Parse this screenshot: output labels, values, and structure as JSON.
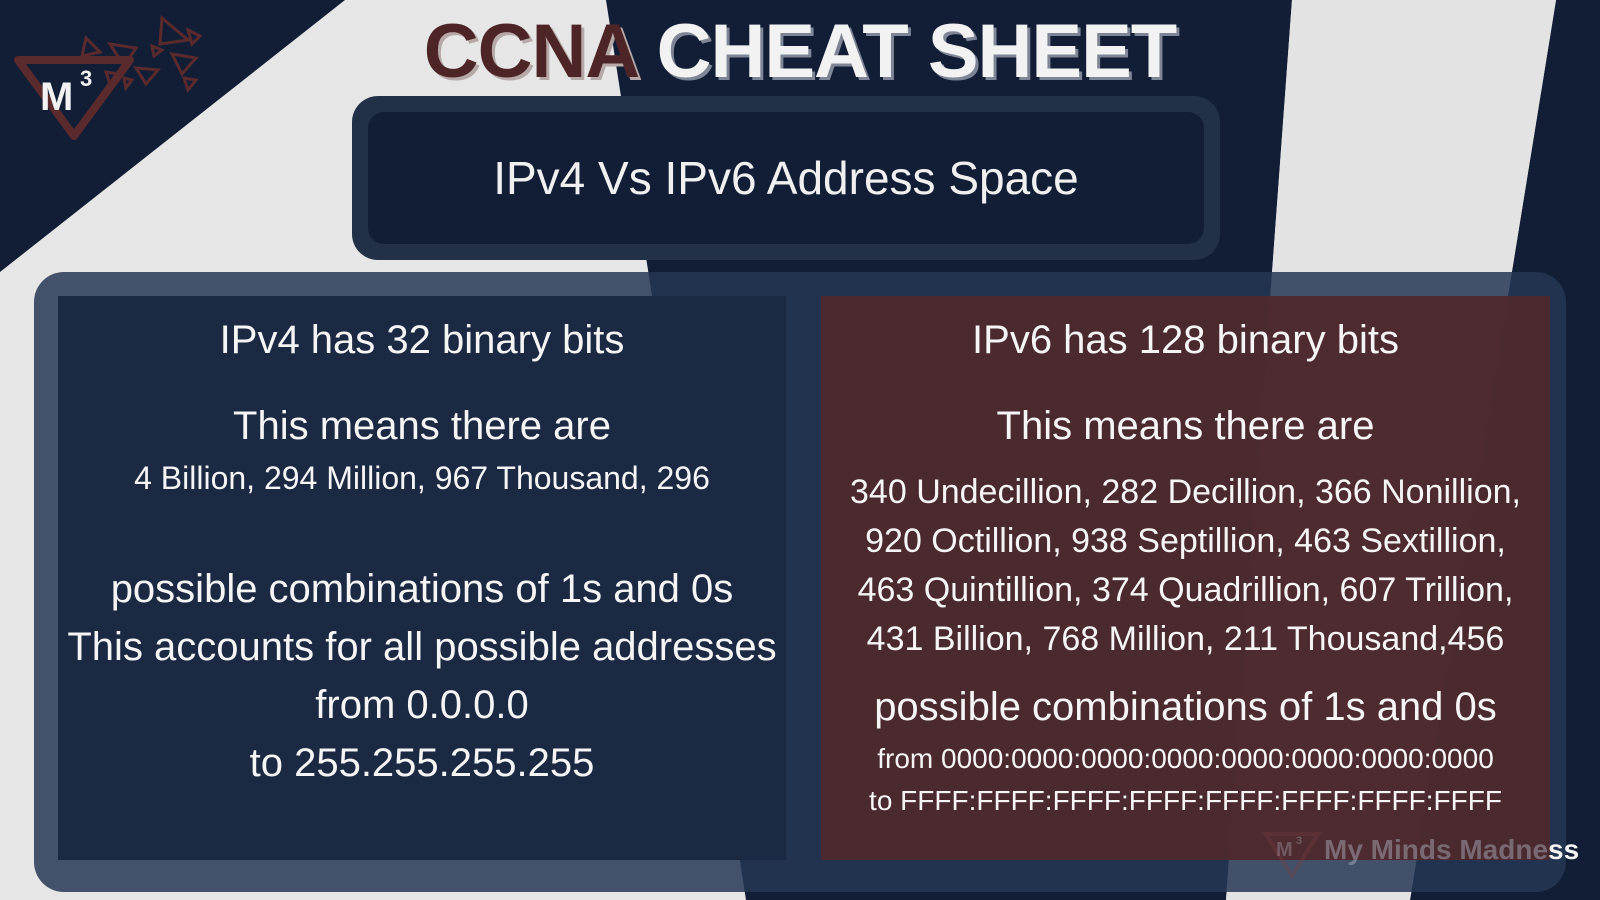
{
  "title": {
    "word1": "CCNA",
    "word2": "CHEAT SHEET"
  },
  "logo": {
    "mark": "M",
    "superscript": "3"
  },
  "subtitle": "IPv4 Vs IPv6 Address Space",
  "ipv4": {
    "heading": "IPv4 has 32 binary bits",
    "means": "This means there are",
    "count": "4 Billion, 294 Million, 967 Thousand, 296",
    "lines": [
      "possible combinations of 1s and 0s",
      "This accounts for all possible addresses",
      "from 0.0.0.0",
      "to 255.255.255.255"
    ]
  },
  "ipv6": {
    "heading": "IPv6 has 128 binary bits",
    "means": "This means there are",
    "count_lines": [
      "340 Undecillion, 282 Decillion, 366 Nonillion,",
      "920 Octillion, 938 Septillion, 463 Sextillion,",
      "463 Quintillion, 374 Quadrillion, 607 Trillion,",
      "431 Billion, 768 Million, 211 Thousand,456"
    ],
    "combinations": "possible combinations of 1s and 0s",
    "from": "from 0000:0000:0000:0000:0000:0000:0000:0000",
    "to": "to FFFF:FFFF:FFFF:FFFF:FFFF:FFFF:FFFF:FFFF"
  },
  "watermark": {
    "text_faded": "My Minds Madne",
    "text_tail": "ss",
    "mark": "M",
    "superscript": "3"
  },
  "colors": {
    "navy": "#121e36",
    "maroon": "#4e2527",
    "background": "#e6e6e6"
  }
}
